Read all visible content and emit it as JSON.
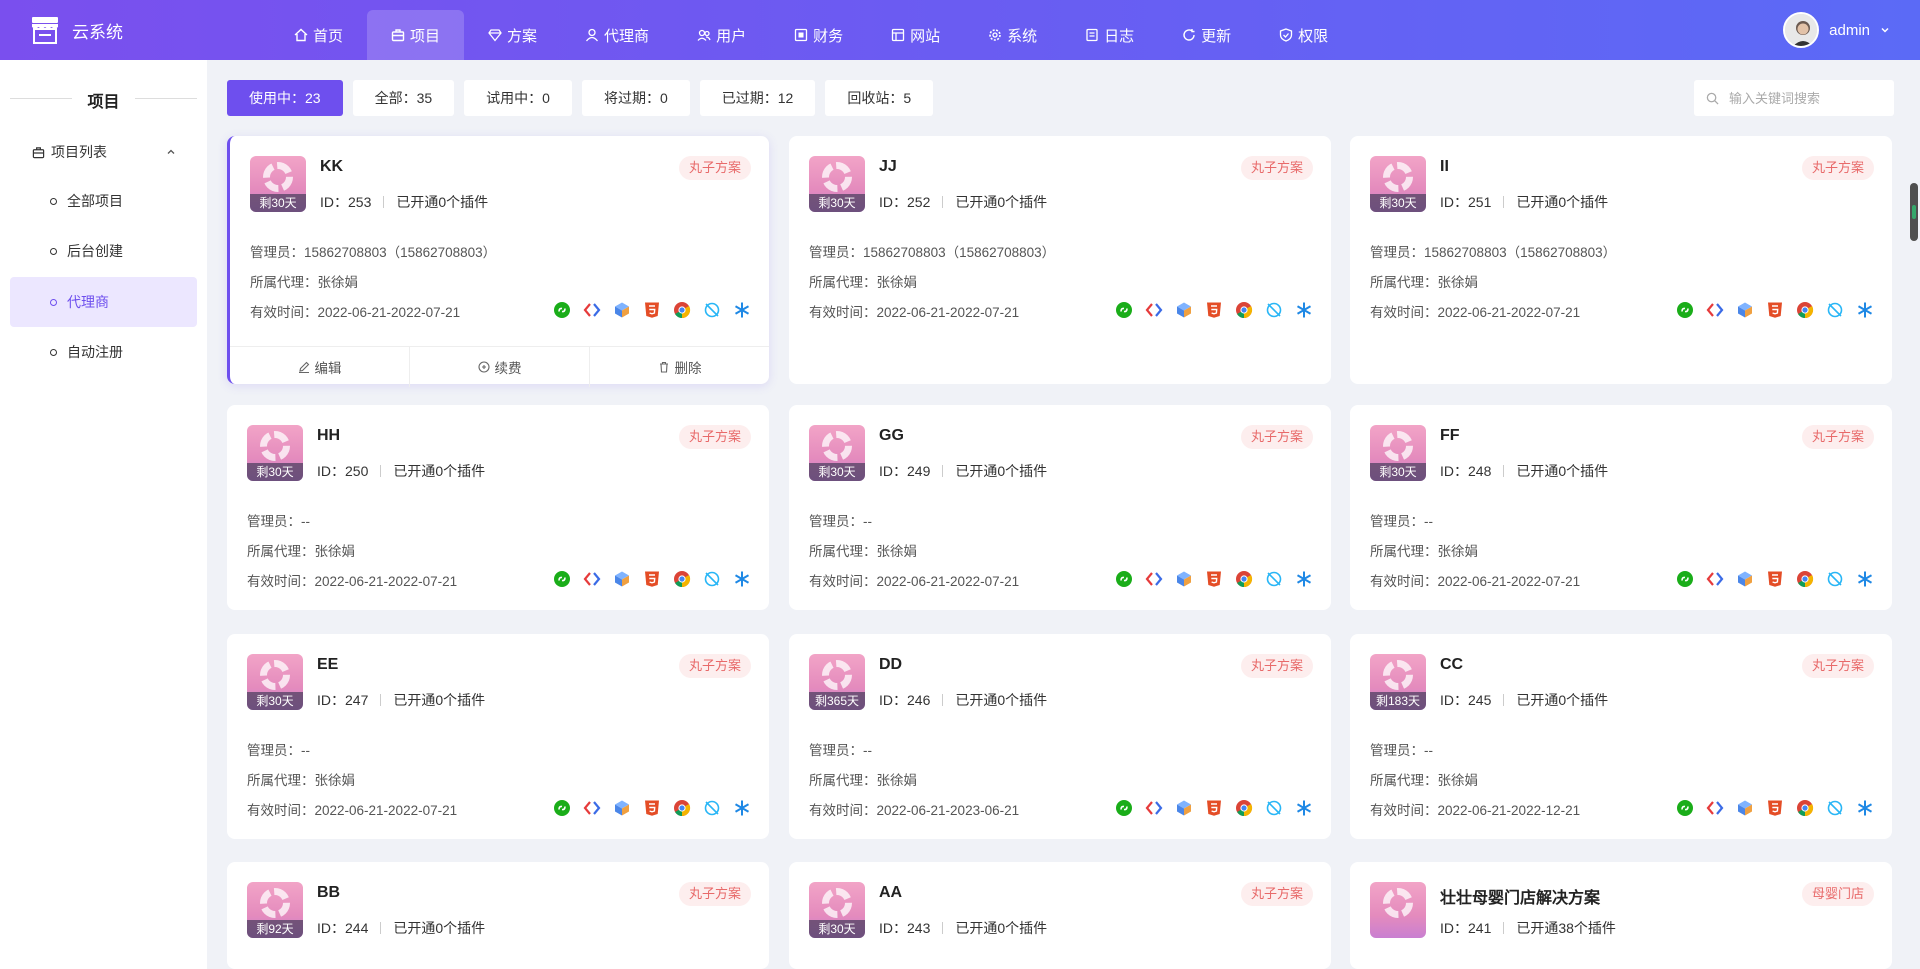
{
  "header": {
    "brand": "云系统",
    "nav": [
      {
        "label": "首页",
        "icon": "home-icon"
      },
      {
        "label": "项目",
        "icon": "briefcase-icon",
        "active": true
      },
      {
        "label": "方案",
        "icon": "diamond-icon"
      },
      {
        "label": "代理商",
        "icon": "agent-icon"
      },
      {
        "label": "用户",
        "icon": "users-icon"
      },
      {
        "label": "财务",
        "icon": "finance-icon"
      },
      {
        "label": "网站",
        "icon": "website-icon"
      },
      {
        "label": "系统",
        "icon": "gear-icon"
      },
      {
        "label": "日志",
        "icon": "log-icon"
      },
      {
        "label": "更新",
        "icon": "refresh-icon"
      },
      {
        "label": "权限",
        "icon": "shield-icon"
      }
    ],
    "user": "admin"
  },
  "sidebar": {
    "title": "项目",
    "group": "项目列表",
    "items": [
      {
        "label": "全部项目"
      },
      {
        "label": "后台创建"
      },
      {
        "label": "代理商",
        "active": true
      },
      {
        "label": "自动注册"
      }
    ]
  },
  "filters": [
    {
      "label": "使用中：23",
      "active": true
    },
    {
      "label": "全部：35"
    },
    {
      "label": "试用中：0"
    },
    {
      "label": "将过期：0"
    },
    {
      "label": "已过期：12"
    },
    {
      "label": "回收站：5"
    }
  ],
  "search": {
    "placeholder": "输入关键词搜索"
  },
  "card_labels": {
    "admin": "管理员：",
    "agent": "所属代理：",
    "valid": "有效时间：",
    "edit": "编辑",
    "renew": "续费",
    "delete": "删除"
  },
  "cards": [
    {
      "name": "KK",
      "days": "剩30天",
      "id": "ID：253",
      "plugins": "已开通0个插件",
      "tag": "丸子方案",
      "admin": "15862708803（15862708803）",
      "agent": "张徐娟",
      "valid": "2022-06-21-2022-07-21"
    },
    {
      "name": "JJ",
      "days": "剩30天",
      "id": "ID：252",
      "plugins": "已开通0个插件",
      "tag": "丸子方案",
      "admin": "15862708803（15862708803）",
      "agent": "张徐娟",
      "valid": "2022-06-21-2022-07-21"
    },
    {
      "name": "II",
      "days": "剩30天",
      "id": "ID：251",
      "plugins": "已开通0个插件",
      "tag": "丸子方案",
      "admin": "15862708803（15862708803）",
      "agent": "张徐娟",
      "valid": "2022-06-21-2022-07-21"
    },
    {
      "name": "HH",
      "days": "剩30天",
      "id": "ID：250",
      "plugins": "已开通0个插件",
      "tag": "丸子方案",
      "admin": "--",
      "agent": "张徐娟",
      "valid": "2022-06-21-2022-07-21"
    },
    {
      "name": "GG",
      "days": "剩30天",
      "id": "ID：249",
      "plugins": "已开通0个插件",
      "tag": "丸子方案",
      "admin": "--",
      "agent": "张徐娟",
      "valid": "2022-06-21-2022-07-21"
    },
    {
      "name": "FF",
      "days": "剩30天",
      "id": "ID：248",
      "plugins": "已开通0个插件",
      "tag": "丸子方案",
      "admin": "--",
      "agent": "张徐娟",
      "valid": "2022-06-21-2022-07-21"
    },
    {
      "name": "EE",
      "days": "剩30天",
      "id": "ID：247",
      "plugins": "已开通0个插件",
      "tag": "丸子方案",
      "admin": "--",
      "agent": "张徐娟",
      "valid": "2022-06-21-2022-07-21"
    },
    {
      "name": "DD",
      "days": "剩365天",
      "id": "ID：246",
      "plugins": "已开通0个插件",
      "tag": "丸子方案",
      "admin": "--",
      "agent": "张徐娟",
      "valid": "2022-06-21-2023-06-21"
    },
    {
      "name": "CC",
      "days": "剩183天",
      "id": "ID：245",
      "plugins": "已开通0个插件",
      "tag": "丸子方案",
      "admin": "--",
      "agent": "张徐娟",
      "valid": "2022-06-21-2022-12-21"
    },
    {
      "name": "BB",
      "days": "剩92天",
      "id": "ID：244",
      "plugins": "已开通0个插件",
      "tag": "丸子方案"
    },
    {
      "name": "AA",
      "days": "剩30天",
      "id": "ID：243",
      "plugins": "已开通0个插件",
      "tag": "丸子方案"
    },
    {
      "name": "壮壮母婴门店解决方案",
      "days": "",
      "id": "ID：241",
      "plugins": "已开通38个插件",
      "tag": "母婴门店"
    }
  ],
  "plugin_icons": [
    "miniprogram-icon",
    "code-icon",
    "cube-icon",
    "html5-icon",
    "chrome-icon",
    "leaf-icon",
    "asterisk-icon"
  ],
  "colors": {
    "accent": "#6e4fee",
    "tag_bg": "#fdeeee",
    "tag_text": "#e86a6a"
  }
}
